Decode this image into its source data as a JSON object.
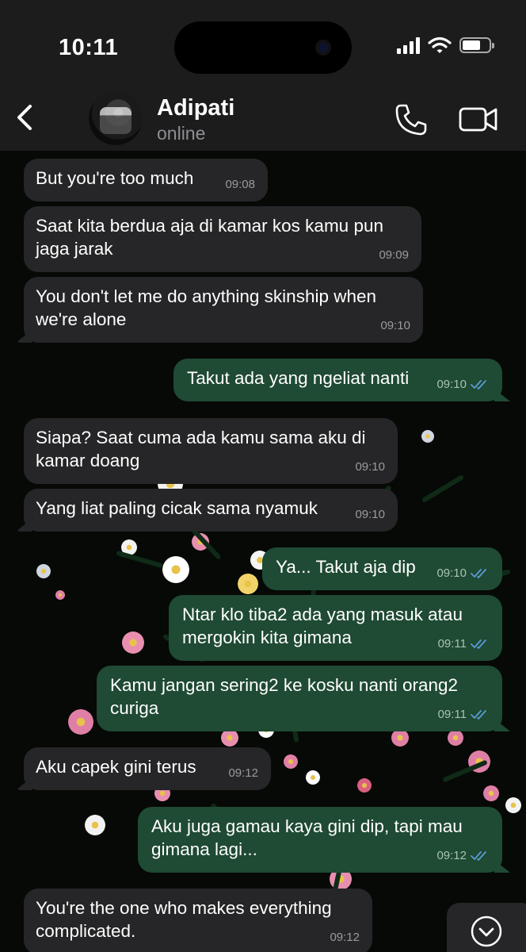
{
  "status_bar": {
    "time": "10:11"
  },
  "contact": {
    "name": "Adipati",
    "presence": "online"
  },
  "messages": [
    {
      "dir": "in",
      "text": "But you're too much",
      "time": "09:08"
    },
    {
      "dir": "in",
      "text": "Saat kita berdua aja di kamar kos kamu pun jaga jarak",
      "time": "09:09"
    },
    {
      "dir": "in",
      "text": "You don't let me do anything skinship when we're alone",
      "time": "09:10"
    },
    {
      "dir": "out",
      "text": "Takut ada yang ngeliat nanti",
      "time": "09:10",
      "read": true
    },
    {
      "dir": "in",
      "text": "Siapa? Saat cuma ada kamu sama aku di kamar doang",
      "time": "09:10"
    },
    {
      "dir": "in",
      "text": "Yang liat paling cicak sama nyamuk",
      "time": "09:10"
    },
    {
      "dir": "out",
      "text": "Ya... Takut aja dip",
      "time": "09:10",
      "read": true
    },
    {
      "dir": "out",
      "text": "Ntar klo tiba2 ada yang masuk atau mergokin kita gimana",
      "time": "09:11",
      "read": true
    },
    {
      "dir": "out",
      "text": "Kamu jangan sering2 ke kosku nanti orang2 curiga",
      "time": "09:11",
      "read": true
    },
    {
      "dir": "in",
      "text": "Aku capek gini terus",
      "time": "09:12"
    },
    {
      "dir": "out",
      "text": "Aku juga gamau kaya gini dip, tapi mau gimana lagi...",
      "time": "09:12",
      "read": true
    },
    {
      "dir": "in",
      "text": "You're the one who makes everything complicated.",
      "time": "09:12"
    }
  ],
  "colors": {
    "incoming": "#262628",
    "outgoing": "#1f4a33",
    "read_ticks": "#5b9bd5",
    "header": "#1c1c1d"
  },
  "icons": [
    "back-chevron-icon",
    "phone-icon",
    "video-camera-icon",
    "signal-icon",
    "wifi-icon",
    "battery-icon",
    "double-check-icon",
    "chevron-down-icon"
  ],
  "battery_level": 0.7
}
